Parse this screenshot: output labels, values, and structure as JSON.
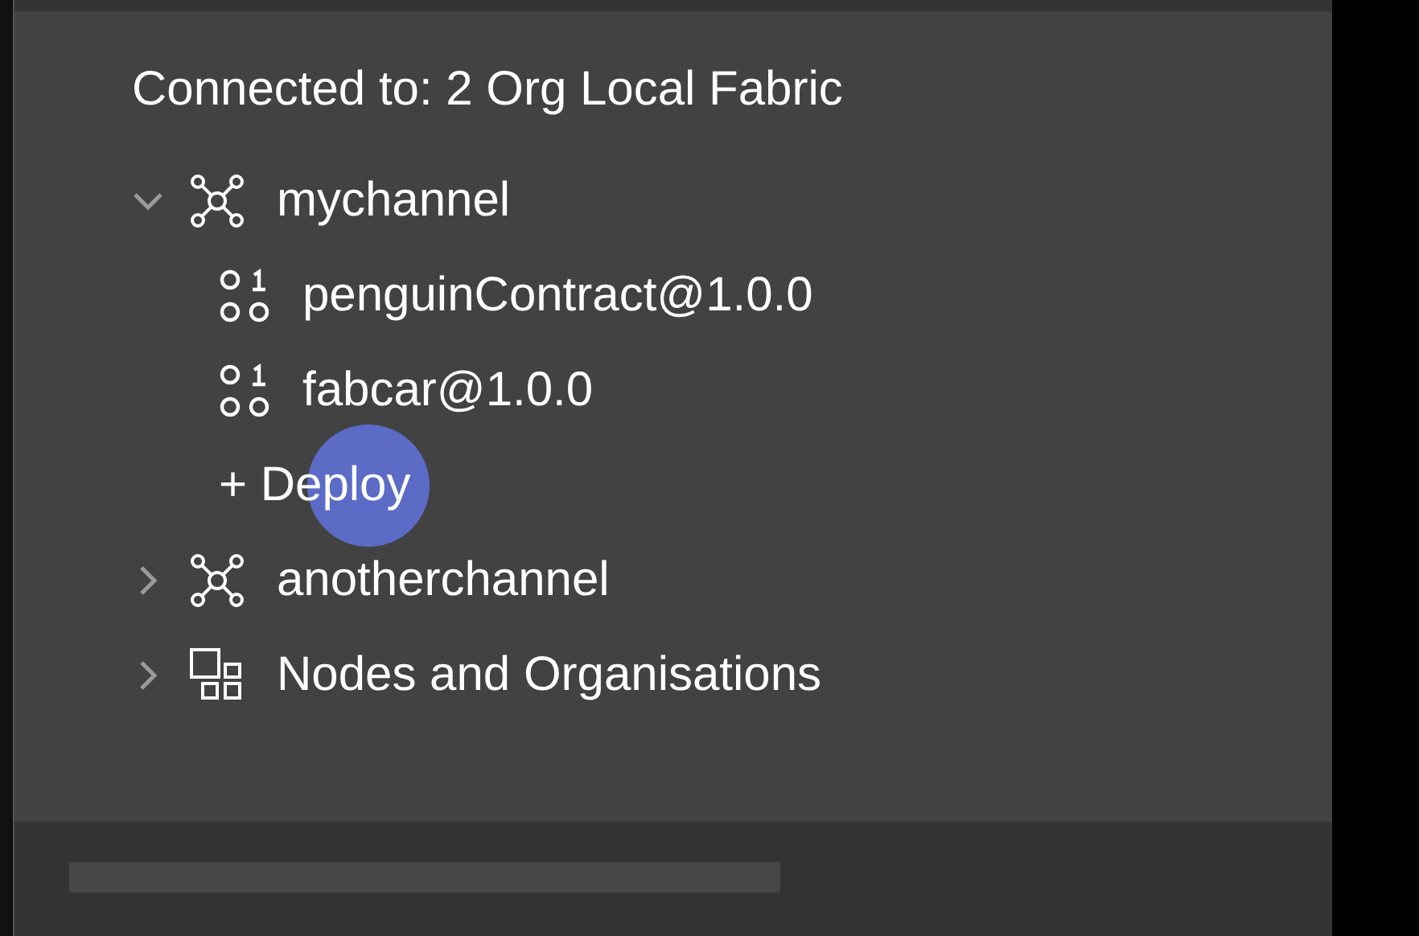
{
  "header": "Connected to: 2 Org Local Fabric",
  "tree": [
    {
      "kind": "channel",
      "label": "mychannel",
      "expanded": true,
      "children": [
        {
          "kind": "contract",
          "label": "penguinContract@1.0.0"
        },
        {
          "kind": "contract",
          "label": "fabcar@1.0.0"
        },
        {
          "kind": "action",
          "label": "+ Deploy"
        }
      ]
    },
    {
      "kind": "channel",
      "label": "anotherchannel",
      "expanded": false
    },
    {
      "kind": "group",
      "label": "Nodes and Organisations",
      "expanded": false
    }
  ]
}
